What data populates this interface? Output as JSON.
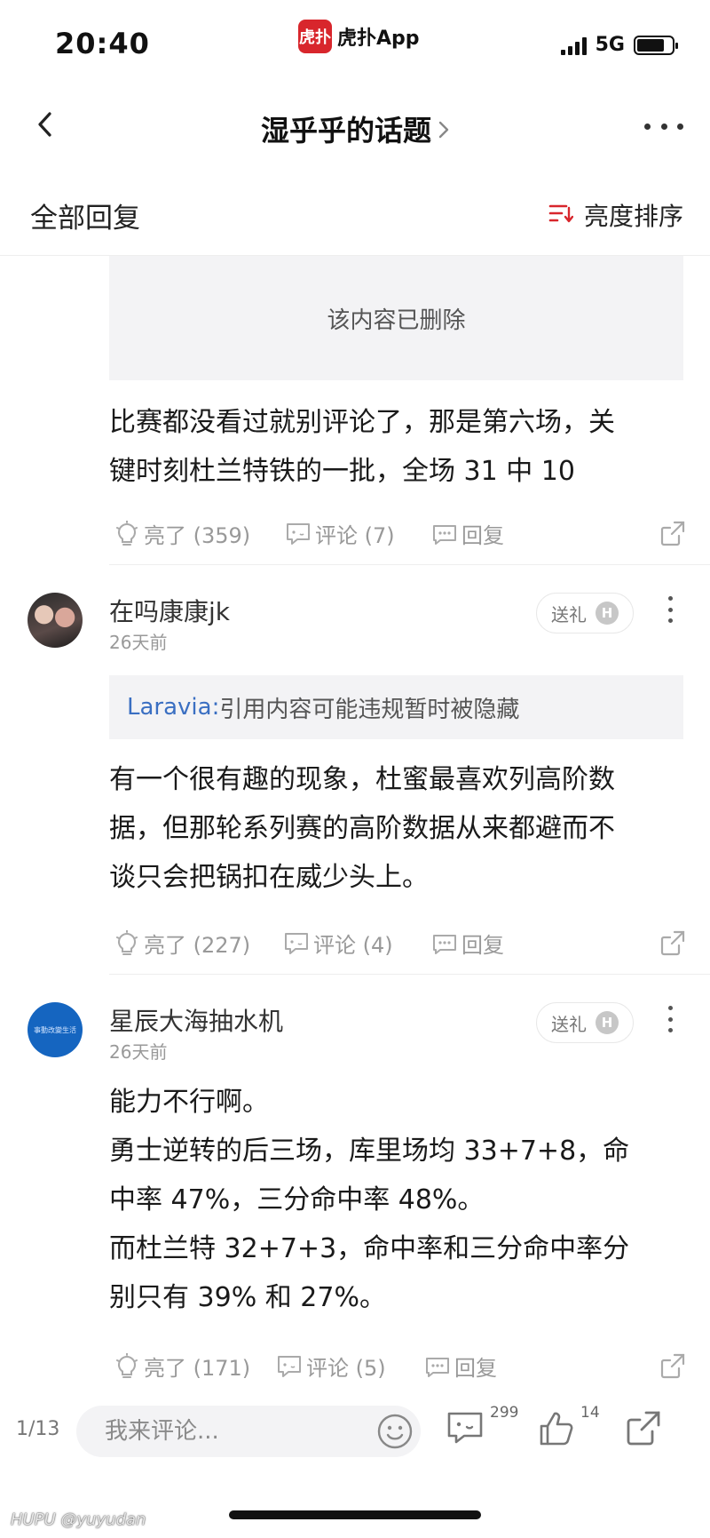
{
  "status_bar": {
    "time": "20:40",
    "app_logo_text": "虎扑",
    "app_name": "虎扑App",
    "network": "5G"
  },
  "nav": {
    "title": "湿乎乎的话题"
  },
  "sort_bar": {
    "title": "全部回复",
    "sort_label": "亮度排序",
    "accent_color": "#d8262c"
  },
  "posts": [
    {
      "deleted_notice": "该内容已删除",
      "body": [
        "比赛都没看过就别评论了，那是第六场，关",
        "键时刻杜兰特铁的一批，全场 31 中 10"
      ],
      "actions": {
        "like": "亮了 (359)",
        "comment": "评论 (7)",
        "reply": "回复"
      }
    },
    {
      "user": "在吗康康jk",
      "time": "26天前",
      "gift_label": "送礼",
      "quote_user": "Laravia:",
      "quote_text": " 引用内容可能违规暂时被隐藏",
      "body": [
        "有一个很有趣的现象，杜蜜最喜欢列高阶数",
        "据，但那轮系列赛的高阶数据从来都避而不",
        "谈只会把锅扣在威少头上。"
      ],
      "actions": {
        "like": "亮了 (227)",
        "comment": "评论 (4)",
        "reply": "回复"
      }
    },
    {
      "user": "星辰大海抽水机",
      "avatar_text": "事動改變生活",
      "time": "26天前",
      "gift_label": "送礼",
      "body": [
        "能力不行啊。",
        "勇士逆转的后三场，库里场均 33+7+8，命",
        "中率 47%，三分命中率 48%。",
        "而杜兰特 32+7+3，命中率和三分命中率分",
        "别只有 39% 和 27%。"
      ],
      "actions": {
        "like": "亮了 (171)",
        "comment": "评论 (5)",
        "reply": "回复"
      }
    }
  ],
  "bottom_bar": {
    "page_indicator": "1/13",
    "input_placeholder": "我来评论...",
    "comment_count": "299",
    "like_count": "14"
  },
  "watermark": "HUPU @yuyudan",
  "icons": {
    "like": "lightbulb-icon",
    "comment": "comment-bubble-icon",
    "reply": "reply-bubble-icon",
    "share": "share-arrow-icon"
  }
}
